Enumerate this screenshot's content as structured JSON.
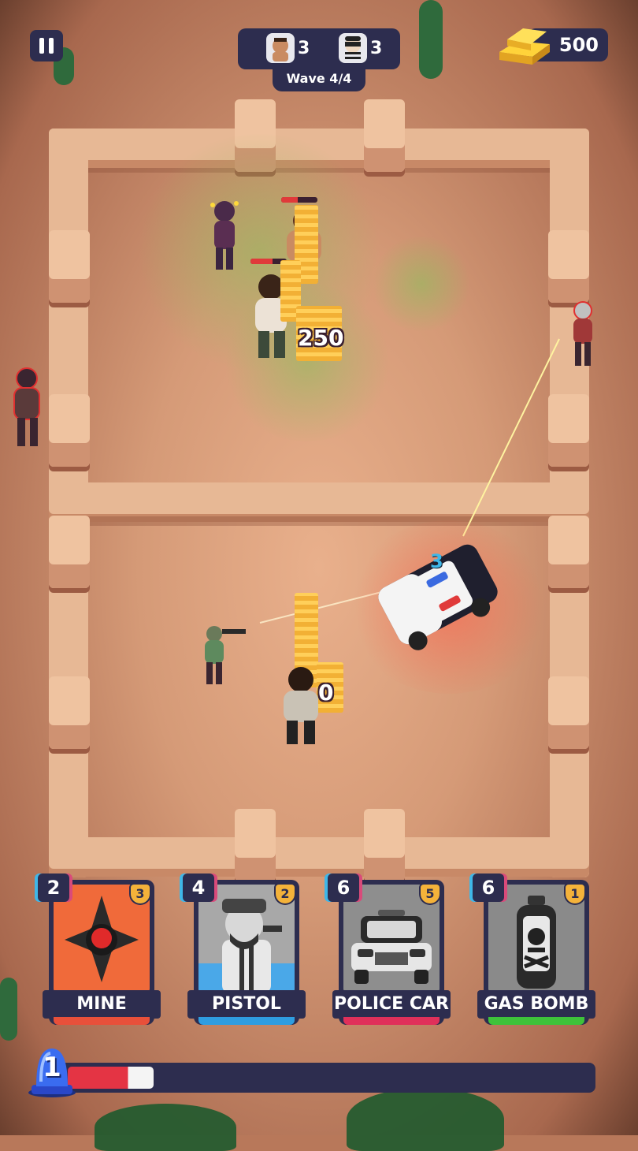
{
  "hud": {
    "enemy_count": "3",
    "robber_count": "3",
    "wave_label": "Wave 4/4",
    "gold": "500"
  },
  "battlefield": {
    "damage_text": "250",
    "damage_text_2": "0",
    "car_level": "3"
  },
  "cards": [
    {
      "name": "MINE",
      "cost": "2",
      "level": "3",
      "stripe_color": "#e8503a",
      "art_color": "#f06a3a",
      "icon": "mine-icon"
    },
    {
      "name": "PISTOL",
      "cost": "4",
      "level": "2",
      "stripe_color": "#2f9de0",
      "art_color": "#9a9a9a",
      "icon": "police-officer-icon"
    },
    {
      "name": "POLICE CAR",
      "cost": "6",
      "level": "5",
      "stripe_color": "#e0305a",
      "art_color": "#8e8e8e",
      "icon": "police-car-icon"
    },
    {
      "name": "GAS BOMB",
      "cost": "6",
      "level": "1",
      "stripe_color": "#3ec23a",
      "art_color": "#8a8a8a",
      "icon": "gas-canister-icon"
    }
  ],
  "energy": {
    "value": "1",
    "fill_fraction": 0.17
  }
}
